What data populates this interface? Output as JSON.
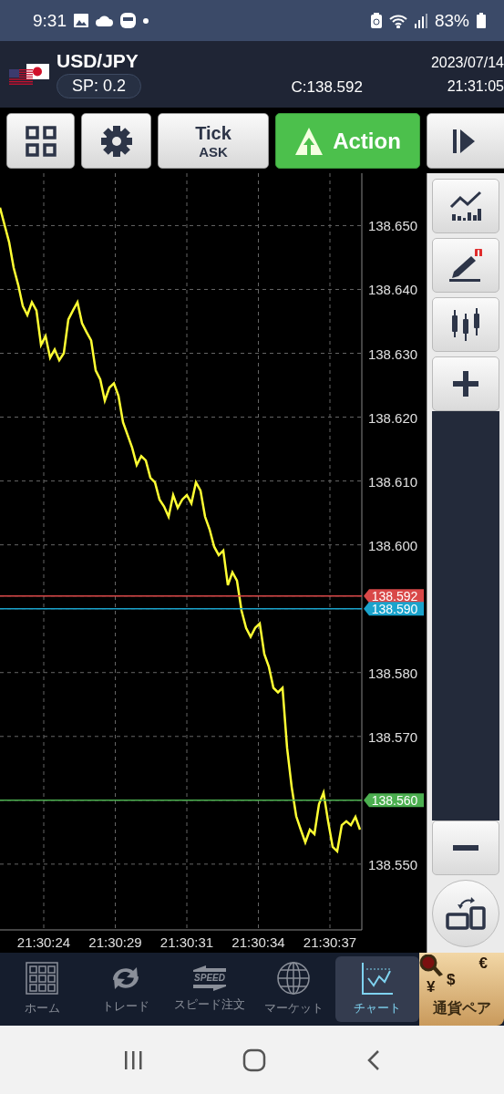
{
  "status_bar": {
    "time": "9:31",
    "battery": "83%"
  },
  "header": {
    "pair": "USD/JPY",
    "spread": "SP: 0.2",
    "close": "C:138.592",
    "date": "2023/07/14",
    "time": "21:31:05"
  },
  "toolbar": [
    {
      "kind": "grid"
    },
    {
      "kind": "settings"
    },
    {
      "kind": "text",
      "label": "Tick",
      "sublabel": "ASK"
    },
    {
      "kind": "action",
      "label": "Action"
    },
    {
      "kind": "play"
    }
  ],
  "chart": {
    "time_labels": [
      "21:30:24",
      "21:30:29",
      "21:30:31",
      "21:30:34",
      "21:30:37"
    ],
    "chart_data": {
      "type": "line",
      "grid": true,
      "ylim": [
        138.5397,
        138.6582
      ],
      "yticks": [
        {
          "value": 138.65,
          "label": "138.650"
        },
        {
          "value": 138.64,
          "label": "138.640"
        },
        {
          "value": 138.63,
          "label": "138.630"
        },
        {
          "value": 138.62,
          "label": "138.620"
        },
        {
          "value": 138.61,
          "label": "138.610"
        },
        {
          "value": 138.6,
          "label": "138.600"
        },
        {
          "value": 138.58,
          "label": "138.580"
        },
        {
          "value": 138.57,
          "label": "138.570"
        },
        {
          "value": 138.55,
          "label": "138.550"
        }
      ],
      "series": [
        {
          "color": "#ffff33",
          "values": [
            138.6528,
            138.6501,
            138.6474,
            138.6434,
            138.6407,
            138.6374,
            138.636,
            138.638,
            138.6367,
            138.6313,
            138.6327,
            138.6293,
            138.6306,
            138.6289,
            138.63,
            138.6353,
            138.6367,
            138.638,
            138.6347,
            138.6333,
            138.632,
            138.6273,
            138.6259,
            138.6226,
            138.6246,
            138.6253,
            138.6233,
            138.6192,
            138.6172,
            138.6152,
            138.6125,
            138.6139,
            138.6132,
            138.6105,
            138.6098,
            138.6071,
            138.606,
            138.6044,
            138.6078,
            138.6058,
            138.6071,
            138.6078,
            138.6065,
            138.6098,
            138.6085,
            138.6044,
            138.6024,
            138.5997,
            138.5984,
            138.5991,
            138.5937,
            138.5957,
            138.5944,
            138.5897,
            138.587,
            138.5856,
            138.587,
            138.5877,
            138.5829,
            138.5809,
            138.5776,
            138.5769,
            138.5776,
            138.5682,
            138.5621,
            138.5575,
            138.5554,
            138.5534,
            138.5554,
            138.5547,
            138.5594,
            138.5612,
            138.5567,
            138.5527,
            138.552,
            138.5561,
            138.5567,
            138.5561,
            138.5574,
            138.5554
          ]
        }
      ],
      "ref_lines": [
        {
          "axis": "y",
          "value": 138.592,
          "label": "138.592",
          "color": "#d94848"
        },
        {
          "axis": "y",
          "value": 138.59,
          "label": "138.590",
          "color": "#1aa3cc"
        },
        {
          "axis": "y",
          "value": 138.56,
          "label": "138.560",
          "color": "#4caf50"
        }
      ]
    }
  },
  "bottom_nav": [
    {
      "kind": "home",
      "label": "ホーム",
      "selected": false
    },
    {
      "kind": "trade",
      "label": "トレード",
      "selected": false
    },
    {
      "kind": "speed",
      "label": "スピード注文",
      "icon_text": "SPEED",
      "selected": false
    },
    {
      "kind": "market",
      "label": "マーケット",
      "selected": false
    },
    {
      "kind": "chart",
      "label": "チャート",
      "selected": true
    }
  ],
  "pair_tab": {
    "label": "通貨ペア",
    "symbols": [
      "€",
      "¥",
      "$"
    ]
  }
}
